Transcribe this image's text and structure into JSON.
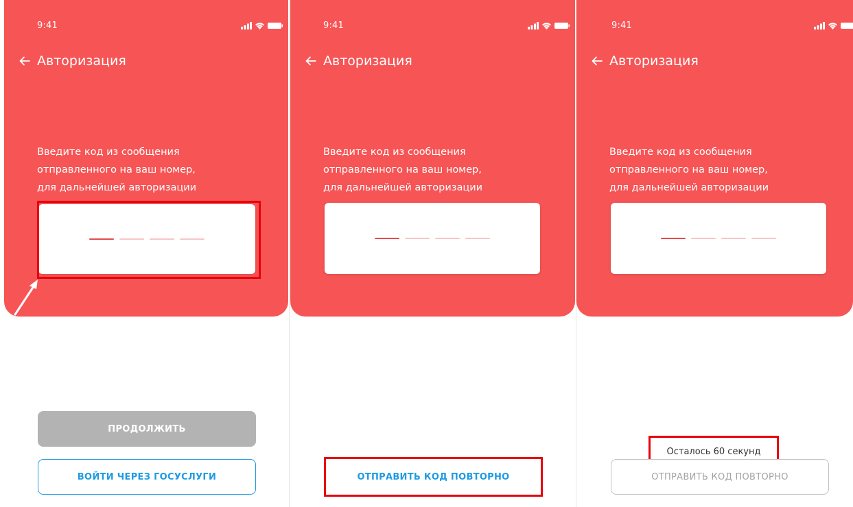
{
  "colors": {
    "brand_red": "#f65455",
    "white": "#ffffff",
    "slot_active": "#e44b4c",
    "slot_inactive": "#f8c5c6",
    "disabled_button_bg": "#b3b3b3",
    "link_blue": "#1e9be3",
    "disabled_border": "#c2c2c2",
    "disabled_text": "#a3a3a3",
    "annotation_red": "#e8000b"
  },
  "status_bar": {
    "time": "9:41"
  },
  "header": {
    "title": "Авторизация",
    "prompt_line1": "Введите код из сообщения",
    "prompt_line2": "отправленного на ваш номер,",
    "prompt_line3": "для дальнейшей авторизации"
  },
  "screens": [
    {
      "continue_label": "ПРОДОЛЖИТЬ",
      "gosuslugi_label": "ВОЙТИ ЧЕРЕЗ ГОСУСЛУГИ"
    },
    {
      "resend_label": "ОТПРАВИТЬ КОД ПОВТОРНО"
    },
    {
      "timer_text": "Осталось 60 секунд",
      "resend_label": "ОТПРАВИТЬ КОД ПОВТОРНО"
    }
  ],
  "icons": {
    "back": "arrow-left-icon",
    "signal": "signal-icon",
    "wifi": "wifi-icon",
    "battery": "battery-icon"
  }
}
